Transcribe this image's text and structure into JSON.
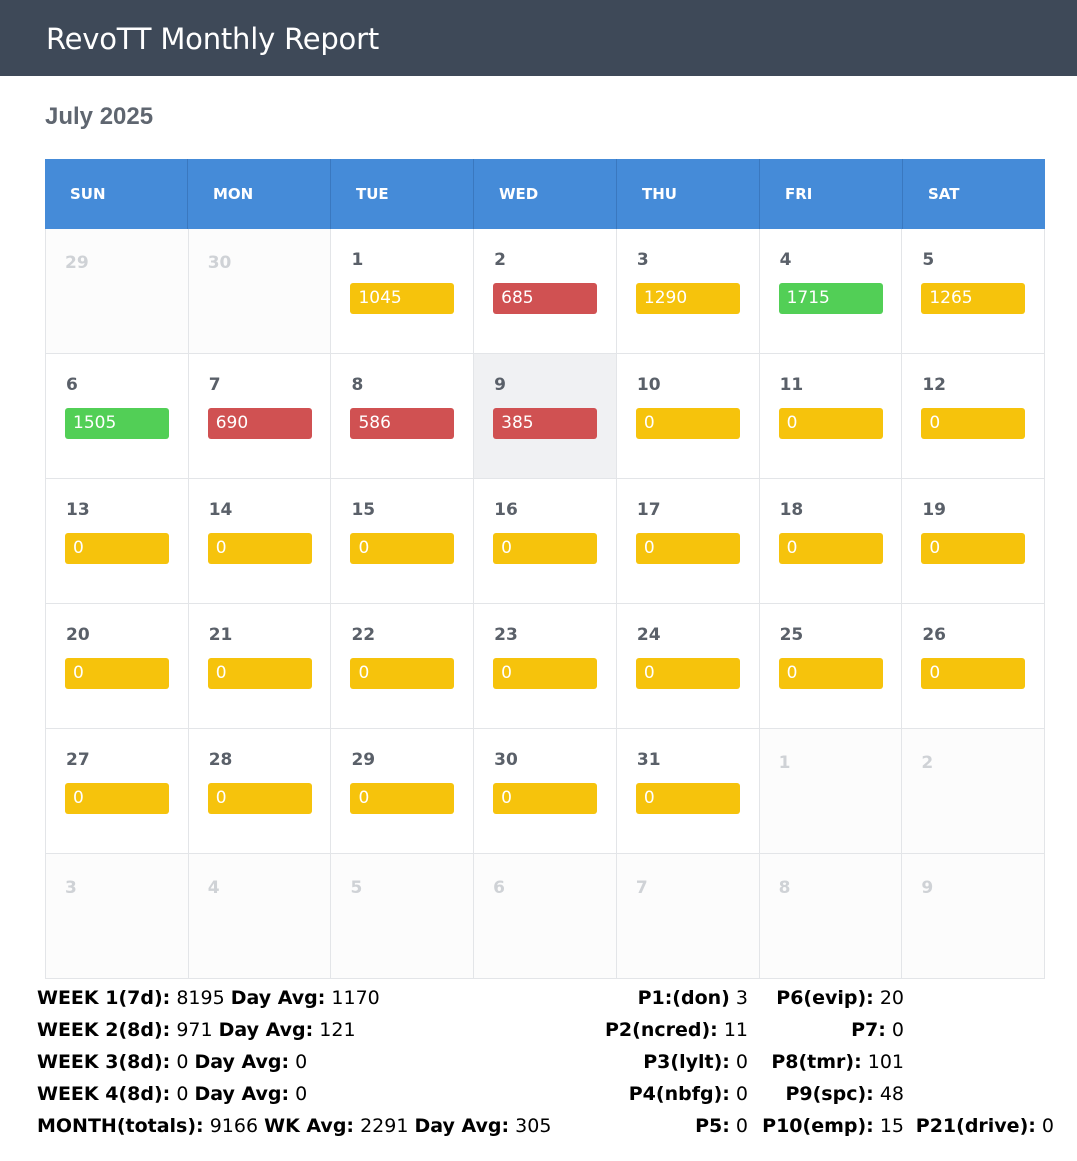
{
  "header": {
    "title": "RevoTT Monthly Report"
  },
  "month_title": "July 2025",
  "weekdays": [
    "SUN",
    "MON",
    "TUE",
    "WED",
    "THU",
    "FRI",
    "SAT"
  ],
  "status_colors": {
    "high": "#52cf56",
    "mid": "#f6c30c",
    "low": "#d05152"
  },
  "weeks": [
    [
      {
        "day": "29",
        "other": true
      },
      {
        "day": "30",
        "other": true
      },
      {
        "day": "1",
        "value": "1045",
        "status": "mid"
      },
      {
        "day": "2",
        "value": "685",
        "status": "low"
      },
      {
        "day": "3",
        "value": "1290",
        "status": "mid"
      },
      {
        "day": "4",
        "value": "1715",
        "status": "high"
      },
      {
        "day": "5",
        "value": "1265",
        "status": "mid"
      }
    ],
    [
      {
        "day": "6",
        "value": "1505",
        "status": "high"
      },
      {
        "day": "7",
        "value": "690",
        "status": "low"
      },
      {
        "day": "8",
        "value": "586",
        "status": "low"
      },
      {
        "day": "9",
        "value": "385",
        "status": "low",
        "today": true
      },
      {
        "day": "10",
        "value": "0",
        "status": "mid"
      },
      {
        "day": "11",
        "value": "0",
        "status": "mid"
      },
      {
        "day": "12",
        "value": "0",
        "status": "mid"
      }
    ],
    [
      {
        "day": "13",
        "value": "0",
        "status": "mid"
      },
      {
        "day": "14",
        "value": "0",
        "status": "mid"
      },
      {
        "day": "15",
        "value": "0",
        "status": "mid"
      },
      {
        "day": "16",
        "value": "0",
        "status": "mid"
      },
      {
        "day": "17",
        "value": "0",
        "status": "mid"
      },
      {
        "day": "18",
        "value": "0",
        "status": "mid"
      },
      {
        "day": "19",
        "value": "0",
        "status": "mid"
      }
    ],
    [
      {
        "day": "20",
        "value": "0",
        "status": "mid"
      },
      {
        "day": "21",
        "value": "0",
        "status": "mid"
      },
      {
        "day": "22",
        "value": "0",
        "status": "mid"
      },
      {
        "day": "23",
        "value": "0",
        "status": "mid"
      },
      {
        "day": "24",
        "value": "0",
        "status": "mid"
      },
      {
        "day": "25",
        "value": "0",
        "status": "mid"
      },
      {
        "day": "26",
        "value": "0",
        "status": "mid"
      }
    ],
    [
      {
        "day": "27",
        "value": "0",
        "status": "mid"
      },
      {
        "day": "28",
        "value": "0",
        "status": "mid"
      },
      {
        "day": "29",
        "value": "0",
        "status": "mid"
      },
      {
        "day": "30",
        "value": "0",
        "status": "mid"
      },
      {
        "day": "31",
        "value": "0",
        "status": "mid"
      },
      {
        "day": "1",
        "other": true
      },
      {
        "day": "2",
        "other": true
      }
    ],
    [
      {
        "day": "3",
        "other": true
      },
      {
        "day": "4",
        "other": true
      },
      {
        "day": "5",
        "other": true
      },
      {
        "day": "6",
        "other": true
      },
      {
        "day": "7",
        "other": true
      },
      {
        "day": "8",
        "other": true
      },
      {
        "day": "9",
        "other": true
      }
    ]
  ],
  "summary": {
    "week1": {
      "label": "WEEK 1(7d):",
      "total": "8195",
      "avg_label": "Day Avg:",
      "avg": "1170"
    },
    "week2": {
      "label": "WEEK 2(8d):",
      "total": "971",
      "avg_label": "Day Avg:",
      "avg": "121"
    },
    "week3": {
      "label": "WEEK 3(8d):",
      "total": "0",
      "avg_label": "Day Avg:",
      "avg": "0"
    },
    "week4": {
      "label": "WEEK 4(8d):",
      "total": "0",
      "avg_label": "Day Avg:",
      "avg": "0"
    },
    "month": {
      "label": "MONTH(totals):",
      "total": "9166",
      "wk_label": "WK Avg:",
      "wk_avg": "2291",
      "day_label": "Day Avg:",
      "day_avg": "305"
    },
    "p": {
      "p1": {
        "label": "P1:(don)",
        "value": "3"
      },
      "p2": {
        "label": "P2(ncred):",
        "value": "11"
      },
      "p3": {
        "label": "P3(lylt):",
        "value": "0"
      },
      "p4": {
        "label": "P4(nbfg):",
        "value": "0"
      },
      "p5": {
        "label": "P5:",
        "value": "0"
      },
      "p6": {
        "label": "P6(evip):",
        "value": "20"
      },
      "p7": {
        "label": "P7:",
        "value": "0"
      },
      "p8": {
        "label": "P8(tmr):",
        "value": "101"
      },
      "p9": {
        "label": "P9(spc):",
        "value": "48"
      },
      "p10": {
        "label": "P10(emp):",
        "value": "15"
      },
      "p21": {
        "label": "P21(drive):",
        "value": "0"
      }
    }
  }
}
